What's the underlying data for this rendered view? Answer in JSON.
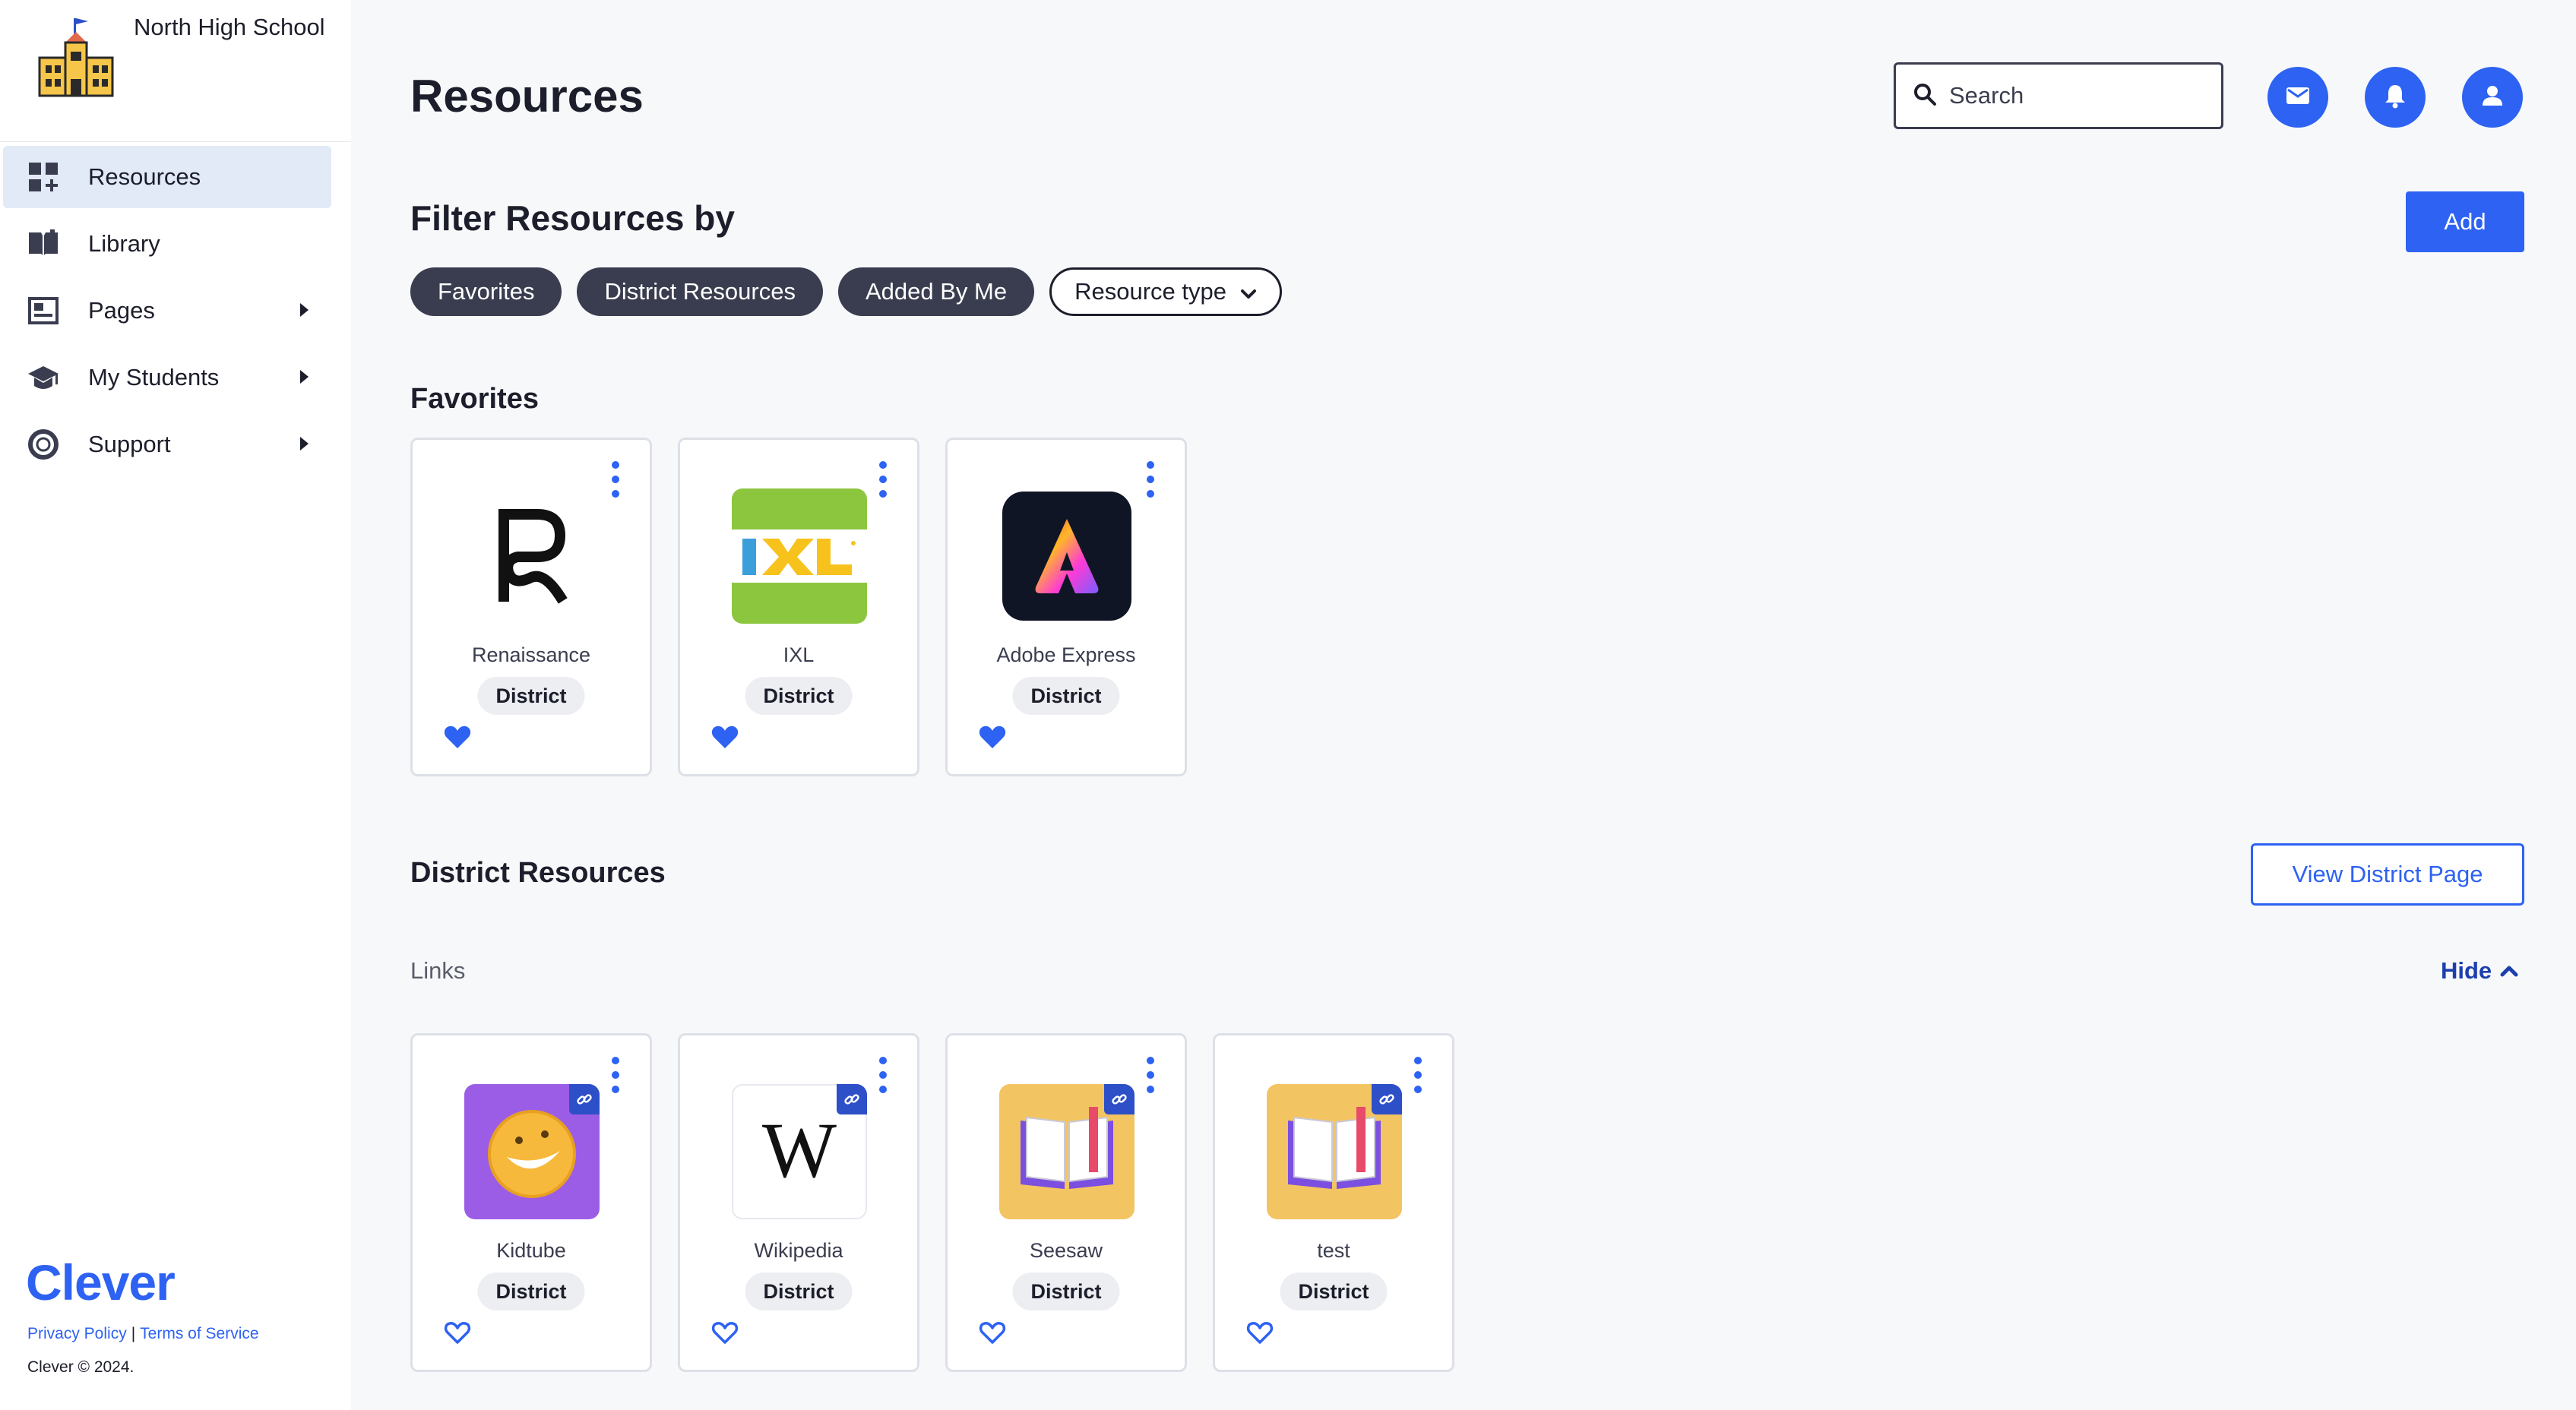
{
  "sidebar": {
    "school_name": "North High School",
    "items": [
      {
        "label": "Resources",
        "icon": "resources-icon",
        "active": true
      },
      {
        "label": "Library",
        "icon": "book-icon"
      },
      {
        "label": "Pages",
        "icon": "page-icon",
        "has_caret": true
      },
      {
        "label": "My Students",
        "icon": "graduation-cap-icon",
        "has_caret": true
      },
      {
        "label": "Support",
        "icon": "lifebuoy-icon",
        "has_caret": true
      }
    ],
    "brand": "Clever",
    "privacy_policy": "Privacy Policy",
    "separator": "|",
    "terms": "Terms of Service",
    "copyright": "Clever © 2024."
  },
  "header": {
    "title": "Resources",
    "search_placeholder": "Search"
  },
  "filters": {
    "title": "Filter Resources by",
    "add_label": "Add",
    "chips": [
      "Favorites",
      "District Resources",
      "Added By Me"
    ],
    "dropdown_label": "Resource type"
  },
  "favorites": {
    "title": "Favorites",
    "cards": [
      {
        "name": "Renaissance",
        "tag": "District",
        "favorited": true
      },
      {
        "name": "IXL",
        "tag": "District",
        "favorited": true
      },
      {
        "name": "Adobe Express",
        "tag": "District",
        "favorited": true
      }
    ]
  },
  "district": {
    "title": "District Resources",
    "view_button": "View District Page",
    "links_label": "Links",
    "hide_label": "Hide",
    "cards": [
      {
        "name": "Kidtube",
        "tag": "District",
        "favorited": false
      },
      {
        "name": "Wikipedia",
        "tag": "District",
        "favorited": false
      },
      {
        "name": "Seesaw",
        "tag": "District",
        "favorited": false
      },
      {
        "name": "test",
        "tag": "District",
        "favorited": false
      }
    ]
  },
  "colors": {
    "accent": "#2d62f2",
    "active_nav_bg": "#e2e9f7",
    "chip_dark": "#3a3d4f"
  }
}
